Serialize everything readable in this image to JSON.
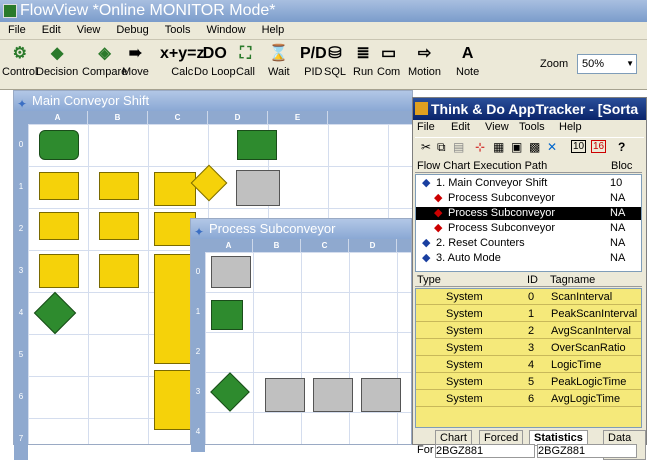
{
  "app": {
    "title": "FlowView *Online MONITOR Mode*"
  },
  "menu": [
    "File",
    "Edit",
    "View",
    "Debug",
    "Tools",
    "Window",
    "Help"
  ],
  "toolbar": {
    "tools": [
      {
        "label": "Control",
        "icon": "control-icon",
        "glyph": "⚙"
      },
      {
        "label": "Decision",
        "icon": "decision-icon",
        "glyph": "◆"
      },
      {
        "label": "Compare",
        "icon": "compare-icon",
        "glyph": "◈"
      },
      {
        "label": "Move",
        "icon": "move-icon",
        "glyph": "➠"
      },
      {
        "label": "Calc",
        "icon": "calc-icon",
        "glyph": "x+y=z"
      },
      {
        "label": "Do Loop",
        "icon": "doloop-icon",
        "glyph": "DO"
      },
      {
        "label": "Call",
        "icon": "call-icon",
        "glyph": "⛶"
      },
      {
        "label": "Wait",
        "icon": "wait-icon",
        "glyph": "⌛"
      },
      {
        "label": "PID",
        "icon": "pid-icon",
        "glyph": "P/D"
      },
      {
        "label": "SQL",
        "icon": "sql-icon",
        "glyph": "⛁"
      },
      {
        "label": "Run",
        "icon": "run-icon",
        "glyph": "≣"
      },
      {
        "label": "Com",
        "icon": "com-icon",
        "glyph": "▭"
      },
      {
        "label": "Motion",
        "icon": "motion-icon",
        "glyph": "⇨"
      },
      {
        "label": "Note",
        "icon": "note-icon",
        "glyph": "A"
      }
    ],
    "zoom_label": "Zoom",
    "zoom_value": "50%"
  },
  "main_window": {
    "title": "Main Conveyor Shift",
    "columns": [
      "A",
      "B",
      "C",
      "D",
      "E"
    ],
    "rows": [
      "0",
      "1",
      "2",
      "3",
      "4",
      "5",
      "6",
      "7"
    ]
  },
  "sub_window": {
    "title": "Process Subconveyor",
    "columns": [
      "A",
      "B",
      "C",
      "D"
    ],
    "rows": [
      "0",
      "1",
      "2",
      "3",
      "4"
    ]
  },
  "tracker": {
    "title": "Think & Do AppTracker - [Sorta",
    "menu": [
      "File",
      "Edit",
      "View",
      "Tools",
      "Help"
    ],
    "tree_header": {
      "path": "Flow Chart Execution Path",
      "col": "Bloc"
    },
    "tree": [
      {
        "label": "1. Main Conveyor Shift",
        "value": "10",
        "indent": 0,
        "selected": false
      },
      {
        "label": "Process Subconveyor",
        "value": "NA",
        "indent": 1,
        "selected": false
      },
      {
        "label": "Process Subconveyor",
        "value": "NA",
        "indent": 1,
        "selected": true
      },
      {
        "label": "Process Subconveyor",
        "value": "NA",
        "indent": 1,
        "selected": false
      },
      {
        "label": "2. Reset Counters",
        "value": "NA",
        "indent": 0,
        "selected": false
      },
      {
        "label": "3. Auto Mode",
        "value": "NA",
        "indent": 0,
        "selected": false
      }
    ],
    "table_header": {
      "type": "Type",
      "id": "ID",
      "tag": "Tagname"
    },
    "table": [
      {
        "type": "System",
        "id": "0",
        "tag": "ScanInterval"
      },
      {
        "type": "System",
        "id": "1",
        "tag": "PeakScanInterval"
      },
      {
        "type": "System",
        "id": "2",
        "tag": "AvgScanInterval"
      },
      {
        "type": "System",
        "id": "3",
        "tag": "OverScanRatio"
      },
      {
        "type": "System",
        "id": "4",
        "tag": "LogicTime"
      },
      {
        "type": "System",
        "id": "5",
        "tag": "PeakLogicTime"
      },
      {
        "type": "System",
        "id": "6",
        "tag": "AvgLogicTime"
      }
    ],
    "tabs": [
      "Chart",
      "Forced",
      "Statistics",
      "Data Item"
    ],
    "active_tab": "Statistics",
    "status_for": "For",
    "status_left": "2BGZ881",
    "status_right": "2BGZ881"
  }
}
